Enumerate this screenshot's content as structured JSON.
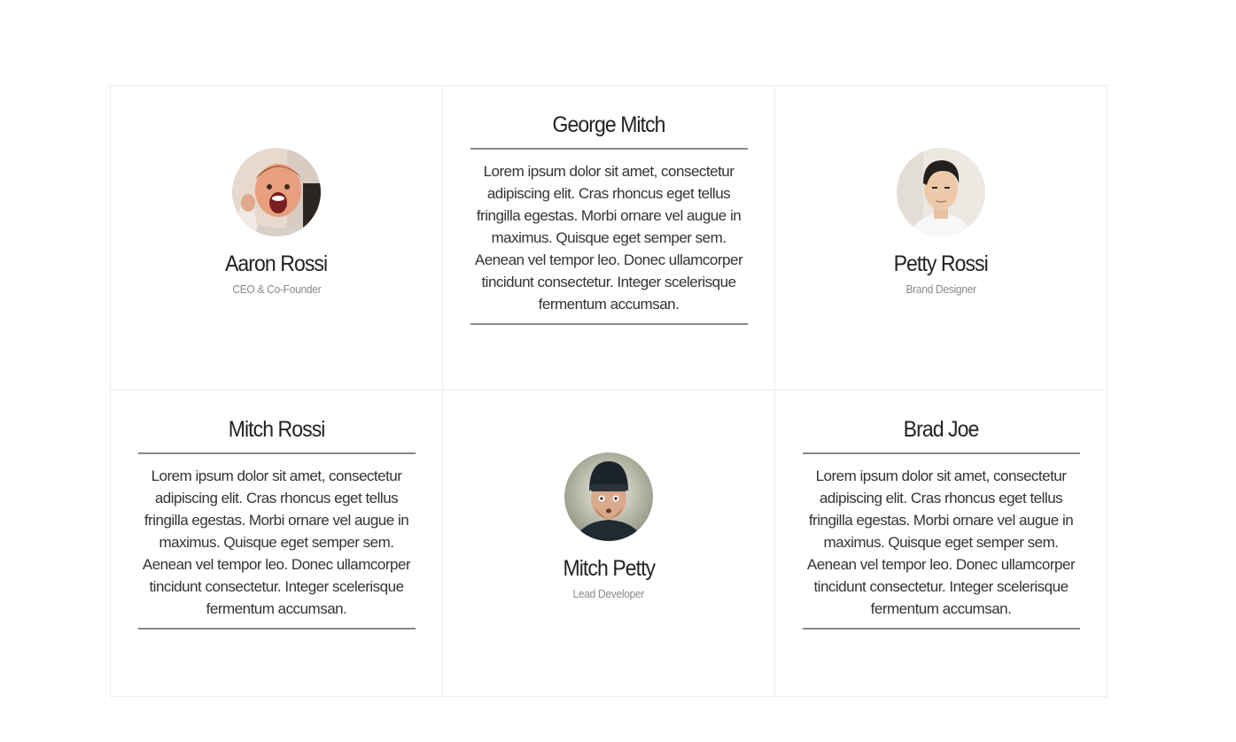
{
  "team": {
    "row1": {
      "aaron": {
        "name": "Aaron Rossi",
        "role": "CEO & Co-Founder"
      },
      "george": {
        "name": "George Mitch",
        "bio": "Lorem ipsum dolor sit amet, consectetur adipiscing elit. Cras rhoncus eget tellus fringilla egestas. Morbi ornare vel augue in maximus. Quisque eget semper sem. Aenean vel tempor leo. Donec ullamcorper tincidunt consectetur. Integer scelerisque fermentum accumsan."
      },
      "petty": {
        "name": "Petty Rossi",
        "role": "Brand Designer"
      }
    },
    "row2": {
      "mitch": {
        "name": "Mitch Rossi",
        "bio": "Lorem ipsum dolor sit amet, consectetur adipiscing elit. Cras rhoncus eget tellus fringilla egestas. Morbi ornare vel augue in maximus. Quisque eget semper sem. Aenean vel tempor leo. Donec ullamcorper tincidunt consectetur. Integer scelerisque fermentum accumsan."
      },
      "mitch_petty": {
        "name": "Mitch Petty",
        "role": "Lead Developer"
      },
      "brad": {
        "name": "Brad Joe",
        "bio": "Lorem ipsum dolor sit amet, consectetur adipiscing elit. Cras rhoncus eget tellus fringilla egestas. Morbi ornare vel augue in maximus. Quisque eget semper sem. Aenean vel tempor leo. Donec ullamcorper tincidunt consectetur. Integer scelerisque fermentum accumsan."
      }
    }
  },
  "colors": {
    "border": "#ececec",
    "divider": "#888888",
    "name": "#222222",
    "role": "#888888"
  },
  "icons": [
    "avatar-photo-aaron",
    "avatar-photo-petty",
    "avatar-photo-mitch-petty"
  ]
}
